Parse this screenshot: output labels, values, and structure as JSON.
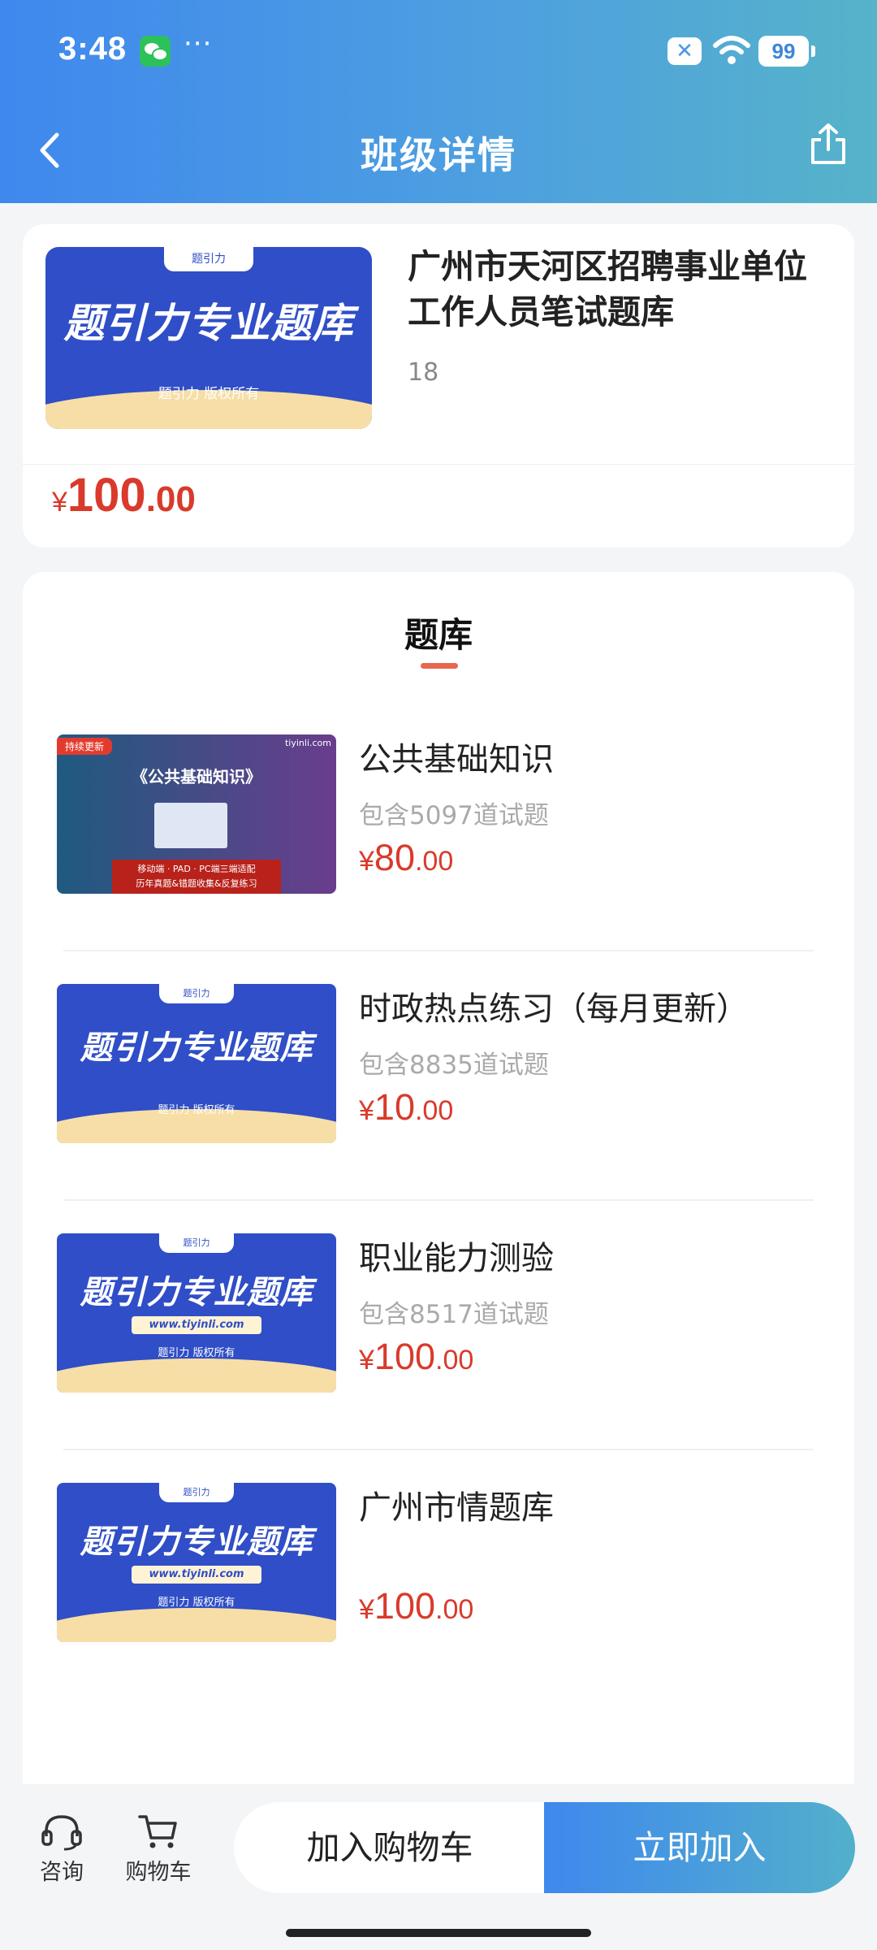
{
  "status_bar": {
    "time": "3:48",
    "dots": "···",
    "battery": "99"
  },
  "nav": {
    "title": "班级详情",
    "back_icon": "chevron-left-icon",
    "share_icon": "share-icon"
  },
  "product": {
    "thumb_title": "题引力专业题库",
    "thumb_footer": "题引力 版权所有",
    "thumb_tab": "题引力",
    "title": "广州市天河区招聘事业单位工作人员笔试题库",
    "count": "18",
    "price": {
      "symbol": "¥",
      "integer": "100",
      "decimal": ".00"
    }
  },
  "section": {
    "title": "题库"
  },
  "banks": [
    {
      "name": "公共基础知识",
      "count_text": "包含5097道试题",
      "price": {
        "symbol": "¥",
        "integer": "80",
        "decimal": ".00"
      },
      "thumb": {
        "style": "public",
        "tag": "持续更新",
        "title": "《公共基础知识》",
        "brand": "tiyinli.com",
        "line1": "移动端 · PAD · PC端三端适配",
        "line2": "历年真题&错题收集&反复练习"
      }
    },
    {
      "name": "时政热点练习（每月更新）",
      "count_text": "包含8835道试题",
      "price": {
        "symbol": "¥",
        "integer": "10",
        "decimal": ".00"
      },
      "thumb": {
        "style": "plain",
        "title": "题引力专业题库",
        "footer": "题引力 版权所有",
        "tab": "题引力"
      }
    },
    {
      "name": "职业能力测验",
      "count_text": "包含8517道试题",
      "price": {
        "symbol": "¥",
        "integer": "100",
        "decimal": ".00"
      },
      "thumb": {
        "style": "url",
        "title": "题引力专业题库",
        "url": "www.tiyinli.com",
        "footer": "题引力 版权所有",
        "tab": "题引力"
      }
    },
    {
      "name": "广州市情题库",
      "count_text": "",
      "price": {
        "symbol": "¥",
        "integer": "100",
        "decimal": ".00"
      },
      "thumb": {
        "style": "url",
        "title": "题引力专业题库",
        "url": "www.tiyinli.com",
        "footer": "题引力 版权所有",
        "tab": "题引力"
      }
    }
  ],
  "bottom_bar": {
    "consult_label": "咨询",
    "cart_label": "购物车",
    "add_cart_label": "加入购物车",
    "join_label": "立即加入"
  },
  "colors": {
    "brand_blue": "#3f88ee",
    "price_red": "#d93a2b",
    "thumb_blue": "#2f4ec7"
  }
}
